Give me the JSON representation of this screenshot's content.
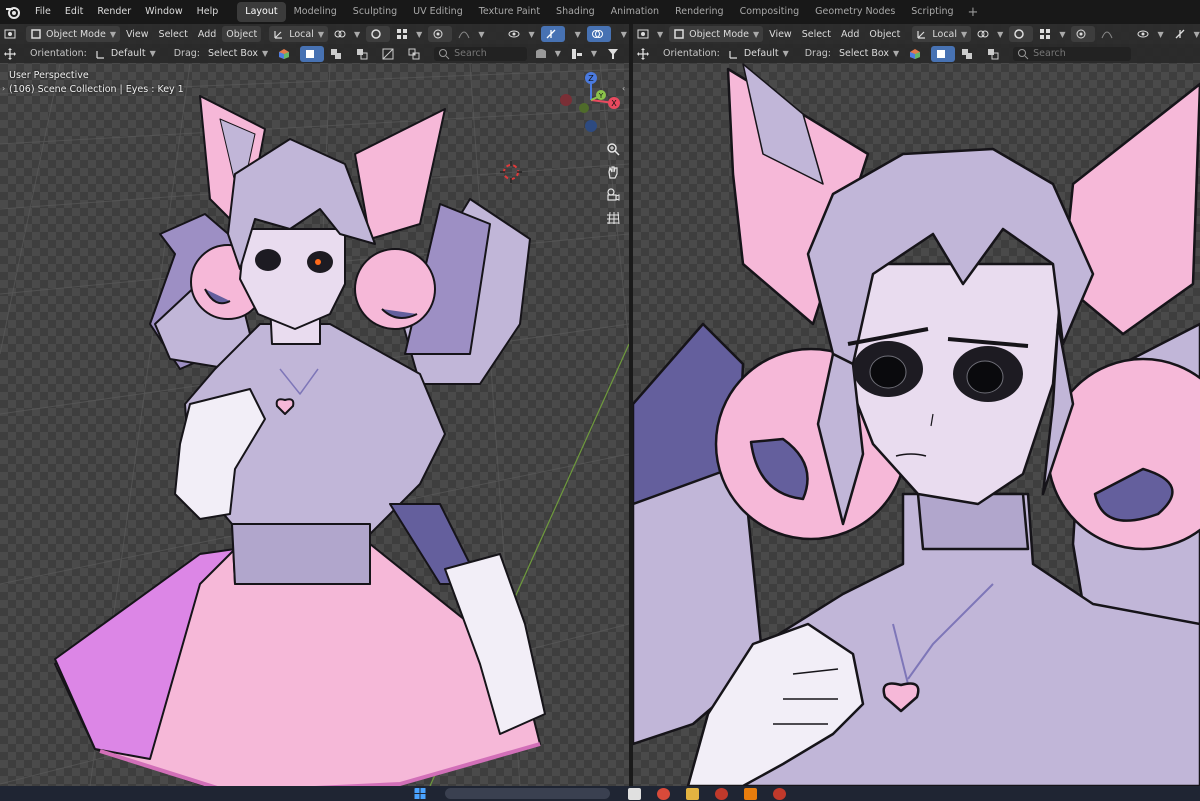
{
  "menu": [
    "File",
    "Edit",
    "Render",
    "Window",
    "Help"
  ],
  "workspaces": [
    {
      "label": "Layout",
      "active": true
    },
    {
      "label": "Modeling"
    },
    {
      "label": "Sculpting"
    },
    {
      "label": "UV Editing"
    },
    {
      "label": "Texture Paint"
    },
    {
      "label": "Shading"
    },
    {
      "label": "Animation"
    },
    {
      "label": "Rendering"
    },
    {
      "label": "Compositing"
    },
    {
      "label": "Geometry Nodes"
    },
    {
      "label": "Scripting"
    }
  ],
  "add_workspace": "+",
  "left": {
    "mode": "Object Mode",
    "menus": [
      "View",
      "Select",
      "Add",
      "Object"
    ],
    "active_menu": "Object",
    "transform_orientation": "Local",
    "toolbar": {
      "orientation_label": "Orientation:",
      "orientation_value": "Default",
      "drag_label": "Drag:",
      "drag_value": "Select Box",
      "search_placeholder": "Search"
    },
    "overlay": {
      "view_name": "User Perspective",
      "collection": "(106) Scene Collection | Eyes : Key 1"
    },
    "gizmo": {
      "x": "X",
      "y": "Y",
      "z": "Z"
    }
  },
  "right": {
    "mode": "Object Mode",
    "menus": [
      "View",
      "Select",
      "Add",
      "Object"
    ],
    "transform_orientation": "Local",
    "toolbar": {
      "orientation_label": "Orientation:",
      "orientation_value": "Default",
      "drag_label": "Drag:",
      "drag_value": "Select Box",
      "search_placeholder": "Search"
    }
  },
  "colors": {
    "skin": "#e9dcef",
    "lavender": "#c1b6d8",
    "hair_shade": "#9d8fc4",
    "pink": "#f6b8d8",
    "magenta": "#dc86e6",
    "deep_violet": "#645f9d",
    "outline": "#161419",
    "accent_blue": "#4772b3"
  }
}
